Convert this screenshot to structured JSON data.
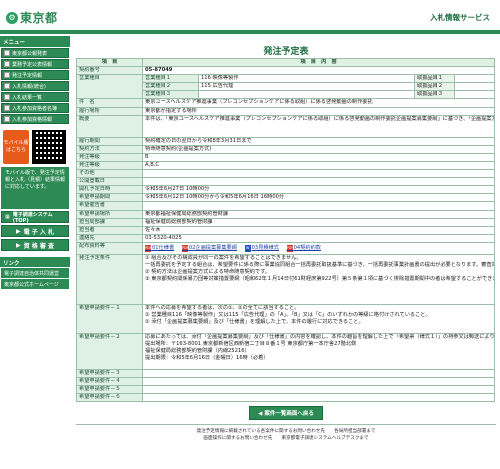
{
  "header": {
    "logo_text": "東京都",
    "service_title": "入札情報サービス"
  },
  "sidebar": {
    "menu_head": "メニュー",
    "items": [
      {
        "label": "東京都公報発表"
      },
      {
        "label": "業務予定公表情報"
      },
      {
        "label": "発注予定情報"
      },
      {
        "label": "入札情報(統合)"
      },
      {
        "label": "入札結果一覧"
      },
      {
        "label": "入札参加資格者名簿"
      },
      {
        "label": "入札参加資格情報"
      }
    ],
    "mobile_label": "モバイル版はこちら",
    "mobile_note": "モバイル版で、発注予定情報と入札（見積）結果情報に対応しています。",
    "system_btn": "電子調達システム(TOP)",
    "bid_btn": "電 子 入 札",
    "qual_btn": "資 格 審 査",
    "links_head": "リンク",
    "links": [
      {
        "label": "電子調達自治体共同運営"
      },
      {
        "label": "東京都公式ホームページ"
      }
    ]
  },
  "main": {
    "page_title": "発注予定表",
    "col_item": "項　目",
    "col_content": "項　目　内　容",
    "contract_no_label": "契約番号",
    "contract_no": "05-87049",
    "business_label": "営業種目",
    "business_rows": [
      {
        "no": "営業種目１",
        "value": "116 映像等製作",
        "cat": "取扱品目１"
      },
      {
        "no": "営業種目２",
        "value": "115 広告代理",
        "cat": "取扱品目２"
      },
      {
        "no": "営業種目３",
        "value": "",
        "cat": "取扱品目３"
      }
    ],
    "rows": [
      {
        "label": "件　名",
        "value": "東京ユースヘルスケア推進事業（プレコンセプションケアに係る取組）に係る啓発動画の制作委託"
      },
      {
        "label": "履行場所",
        "value": "東京都が指定する場所"
      },
      {
        "label": "概要",
        "value": "本件は、「東京ユースヘルスケア推進事業（プレコンセプションケアに係る取組）に係る啓発動画の制作委託企画提案募集要綱」に基づき、「企画提案方式」により採用者を決定します。"
      },
      {
        "label": "履行期間",
        "value": "契約確定の日の翌日から令和8年3月31日まで"
      },
      {
        "label": "契約方法",
        "value": "特命随意契約(企画提案方式)"
      },
      {
        "label": "発注等級",
        "value": "B"
      },
      {
        "label": "発注等級",
        "value": "A,B,C"
      },
      {
        "label": "その他",
        "value": ""
      },
      {
        "label": "公開登載日",
        "value": ""
      },
      {
        "label": "開札予定日時",
        "value": "令和5年6月27日 10時00分"
      },
      {
        "label": "希望申請期間",
        "value": "令和5年6月12日 10時00分から令和5年6月16日 16時00分"
      },
      {
        "label": "希望催告書",
        "value": ""
      },
      {
        "label": "希望申請場所",
        "value": "東京都福祉保健局総務部契約管財課"
      },
      {
        "label": "担当局部課",
        "value": "福祉保健局総務部契約管財課"
      },
      {
        "label": "担当者",
        "value": "佐々木"
      },
      {
        "label": "連絡先",
        "value": "03-5320-4025"
      }
    ],
    "docs_label": "配布資料等",
    "docs": [
      {
        "label": "01仕様書"
      },
      {
        "label": "02企画提案募集要綱"
      },
      {
        "label": "03見積様式"
      },
      {
        "label": "04契約約款"
      }
    ],
    "conditions_label": "発注予定条件",
    "conditions": [
      "① 組合及びその構成員が同一の案件を希望することはできません。",
      "一括再委託を予定する組合は、希望要件に係る際に事業協同組合一括再委託取扱基準に基づき、一括再委託事業計画書の提出が必要となります。審査対象事業者の候補者として登録されている場合は、組合が一括再委託にしなければなりません。",
      "② 契約方法は企画提案方式による特命随意契約です。",
      "③ 東京都契約関係暴力団等対策措置要綱（昭和62年１月14日付61財経庶第922号）第５条第１項に基づく排除措置期間中の者は希望することができません。"
    ],
    "req1_label": "希望申請要件－１",
    "req1": [
      "本件への応募を希望する者は、次の①、②の全てに該当すること。",
      "① 営業種目116「映像等製作」又は115「広告代理」の「A」、「B」又は「C」のいずれかの等級に格付けされていること。",
      "② 添付「企画提案募集要綱」及び「仕様書」を理解した上で、本件の履行に対応できること。"
    ],
    "req2_label": "希望申請要件－２",
    "req2": [
      "応募にあたっては、添付「企画提案募集要綱」及び「仕様書」の内容を確認し、本件の趣旨を理解した上で「希望票（様式１）」の持参又は郵送により提出してください。",
      "提出場所：〒163-8001 東京都新宿区西新宿二丁目８番１号 東京都庁第一本庁舎27階北側",
      "福祉保健局総務部契約管財課（内線25216）",
      "提出期限：令和5年6月16日（金曜日）16時（必着）"
    ],
    "req_more": [
      {
        "label": "希望申請要件－３"
      },
      {
        "label": "希望申請要件－４"
      },
      {
        "label": "希望申請要件－５"
      },
      {
        "label": "希望申請要件－６"
      }
    ],
    "back_button": "案件一覧画面へ戻る",
    "footer_lines": [
      "発注予定情報に掲載されている各案件に関するお問い合わせ先　　各局所担当部署まで",
      "画面操作に関するお問い合わせ先　　東京都電子調達システムヘルプデスクまで"
    ]
  },
  "colors": {
    "brand_green": "#2e8a54",
    "label_bg": "#dff0e4",
    "mobile_orange": "#e65b1a"
  }
}
